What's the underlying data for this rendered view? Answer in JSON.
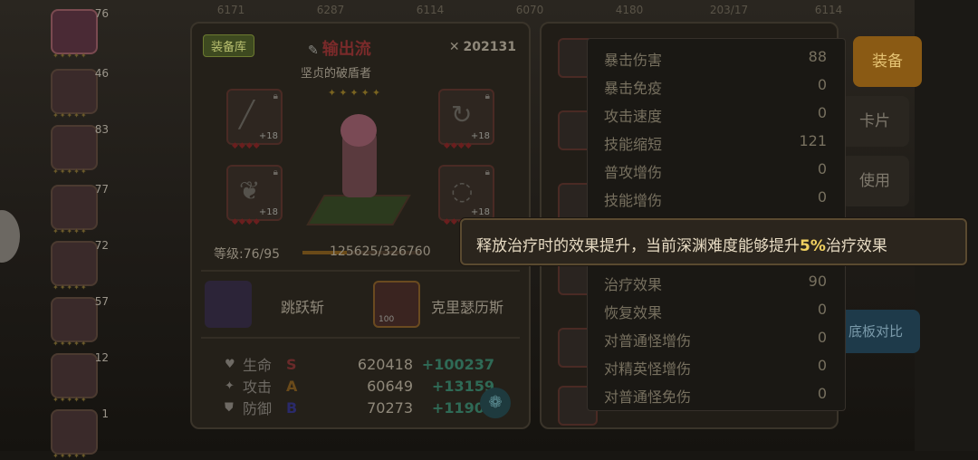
{
  "topbar": [
    "6171",
    "6287",
    "6114",
    "6070",
    "4180",
    "203/17",
    "6114"
  ],
  "heroes": [
    {
      "level": "76",
      "selected": true
    },
    {
      "level": "46",
      "selected": false
    },
    {
      "level": "83",
      "selected": false
    },
    {
      "level": "77",
      "selected": false
    },
    {
      "level": "72",
      "selected": false
    },
    {
      "level": "57",
      "selected": false
    },
    {
      "level": "12",
      "selected": false
    },
    {
      "level": "1",
      "selected": false
    }
  ],
  "panel": {
    "tag": "装备库",
    "role": "输出流",
    "subtitle": "坚贞的破盾者",
    "power": "202131",
    "level_label": "等级:76/95",
    "exp": "125625/326760",
    "exp_fraction": 0.38,
    "slots_plus": [
      "+18",
      "+18",
      "+18",
      "+18"
    ],
    "skill_name": "跳跃斩",
    "card_name": "克里瑟历斯",
    "card_level": "100",
    "stats": [
      {
        "icon": "♥",
        "label": "生命",
        "grade": "S",
        "grade_color": "#6a2a2a",
        "value": "620418",
        "bonus": "+100237"
      },
      {
        "icon": "✦",
        "label": "攻击",
        "grade": "A",
        "grade_color": "#6a4a1a",
        "value": "60649",
        "bonus": "+13159"
      },
      {
        "icon": "⛊",
        "label": "防御",
        "grade": "B",
        "grade_color": "#2a2a6a",
        "value": "70273",
        "bonus": "+11908"
      }
    ]
  },
  "right_tabs": [
    "装备",
    "卡片",
    "使用"
  ],
  "compare_label": "底板对比",
  "popup_stats": [
    {
      "label": "暴击伤害",
      "value": "88"
    },
    {
      "label": "暴击免疫",
      "value": "0"
    },
    {
      "label": "攻击速度",
      "value": "0"
    },
    {
      "label": "技能缩短",
      "value": "121"
    },
    {
      "label": "普攻增伤",
      "value": "0"
    },
    {
      "label": "技能增伤",
      "value": "0"
    },
    {
      "label": "治疗效果",
      "value": "90"
    },
    {
      "label": "恢复效果",
      "value": "0"
    },
    {
      "label": "对普通怪增伤",
      "value": "0"
    },
    {
      "label": "对精英怪增伤",
      "value": "0"
    },
    {
      "label": "对普通怪免伤",
      "value": "0"
    }
  ],
  "tooltip": {
    "before": "释放治疗时的效果提升，当前深渊难度能够提升",
    "highlight": "5%",
    "after": "治疗效果"
  },
  "colors": {
    "accent": "#8a5a14",
    "highlight": "#f0d060",
    "bonus": "#2f6a56"
  }
}
